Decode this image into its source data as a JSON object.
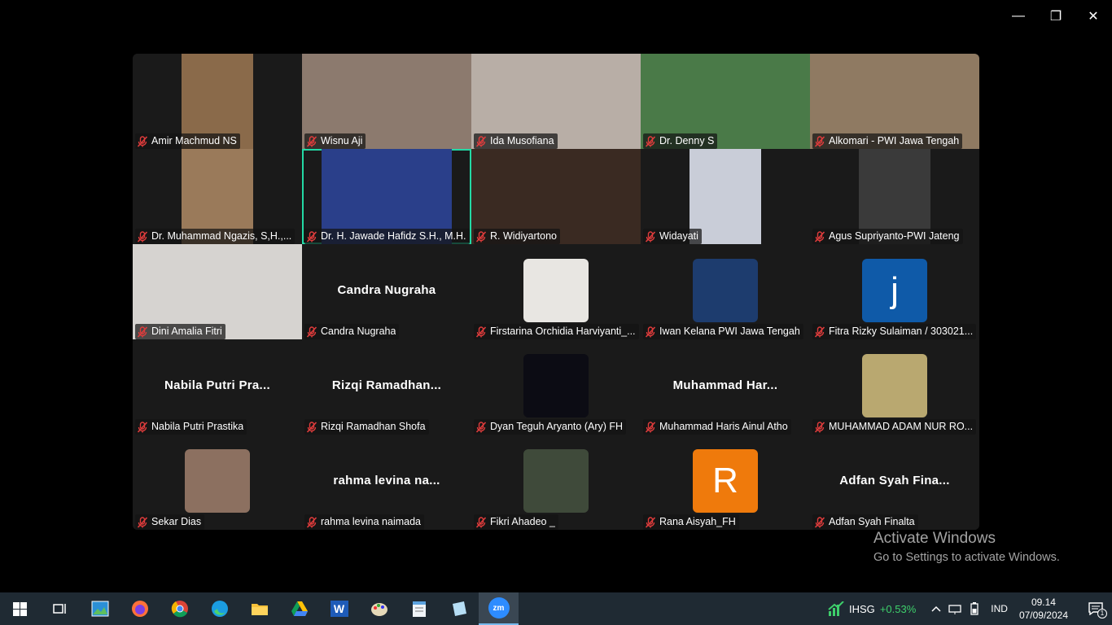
{
  "window": {
    "minimize": "—",
    "restore": "❐",
    "close": "✕"
  },
  "tiles": [
    {
      "name": "Amir Machmud NS",
      "kind": "narrow",
      "bg": "#8a6a4a"
    },
    {
      "name": "Wisnu Aji",
      "kind": "full",
      "bg": "#8c7a6e"
    },
    {
      "name": "Ida Musofiana",
      "kind": "full",
      "bg": "#b8aea6"
    },
    {
      "name": "Dr. Denny S",
      "kind": "full",
      "bg": "#4a7a48"
    },
    {
      "name": "Alkomari - PWI Jawa Tengah",
      "kind": "full",
      "bg": "#8f7a62"
    },
    {
      "name": "Dr. Muhammad Ngazis, S,H.,...",
      "kind": "narrow",
      "bg": "#9a7a5a"
    },
    {
      "name": "Dr. H. Jawade Hafidz S.H., M.H.",
      "kind": "narrow-wide",
      "bg": "#2a3f8a",
      "active": true
    },
    {
      "name": "R. Widiyartono",
      "kind": "full",
      "bg": "#3a2a22"
    },
    {
      "name": "Widayati",
      "kind": "narrow",
      "bg": "#c9cdd8"
    },
    {
      "name": "Agus Supriyanto-PWI Jateng",
      "kind": "narrow",
      "bg": "#3a3a3a"
    },
    {
      "name": "Dini Amalia Fitri",
      "kind": "full",
      "bg": "#d6d3d0"
    },
    {
      "name": "Candra Nugraha",
      "kind": "text",
      "big": "Candra Nugraha"
    },
    {
      "name": "Firstarina Orchidia Harviyanti_...",
      "kind": "thumb",
      "bg": "#e8e6e2"
    },
    {
      "name": "Iwan Kelana PWI Jawa Tengah",
      "kind": "thumb",
      "bg": "#1d3c6e"
    },
    {
      "name": "Fitra Rizky Sulaiman / 303021...",
      "kind": "letter",
      "letter": "j",
      "bg": "#0f5aa8"
    },
    {
      "name": "Nabila Putri Prastika",
      "kind": "text",
      "big": "Nabila  Putri  Pra..."
    },
    {
      "name": "Rizqi Ramadhan Shofa",
      "kind": "text",
      "big": "Rizqi  Ramadhan..."
    },
    {
      "name": "Dyan Teguh Aryanto (Ary) FH",
      "kind": "thumb",
      "bg": "#0c0c14"
    },
    {
      "name": "Muhammad Haris Ainul Atho",
      "kind": "text",
      "big": "Muhammad  Har..."
    },
    {
      "name": "MUHAMMAD ADAM NUR RO...",
      "kind": "thumb",
      "bg": "#b9a870"
    },
    {
      "name": "Sekar Dias",
      "kind": "thumb",
      "bg": "#8c7060"
    },
    {
      "name": "rahma levina naimada",
      "kind": "text",
      "big": "rahma  levina  na..."
    },
    {
      "name": "Fikri Ahadeo _",
      "kind": "thumb",
      "bg": "#3f4a3a"
    },
    {
      "name": "Rana Aisyah_FH",
      "kind": "letter",
      "letter": "R",
      "bg": "#ef7a0c"
    },
    {
      "name": "Adfan Syah Finalta",
      "kind": "text",
      "big": "Adfan  Syah  Fina..."
    }
  ],
  "watermark": {
    "line1": "Activate Windows",
    "line2": "Go to Settings to activate Windows."
  },
  "taskbar": {
    "apps": [
      "start-icon",
      "task-view-icon",
      "photos-icon",
      "firefox-icon",
      "chrome-icon",
      "edge-icon",
      "file-explorer-icon",
      "google-drive-icon",
      "word-icon",
      "paint-icon",
      "notepad-icon",
      "sticky-icon",
      "zoom-icon"
    ],
    "zoom_label": "zm",
    "word_label": "W",
    "stock": {
      "ticker": "IHSG",
      "change": "+0.53%"
    },
    "lang": "IND",
    "time": "09.14",
    "date": "07/09/2024",
    "notif_count": "1"
  },
  "colors": {
    "active_border": "#23d9a5",
    "taskbar": "#1f2a33",
    "mic_muted": "#e03c3c"
  }
}
